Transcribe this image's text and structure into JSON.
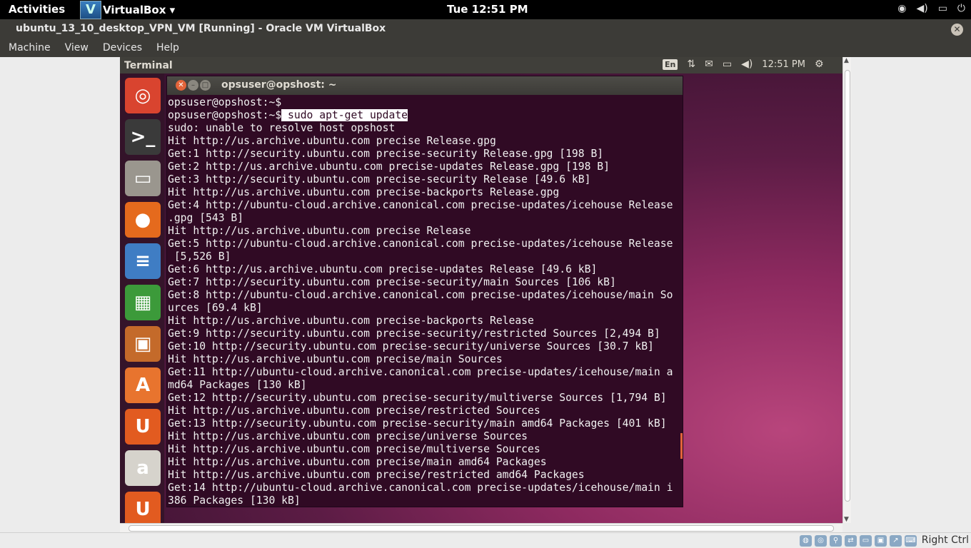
{
  "host_topbar": {
    "activities": "Activities",
    "app_name": "VirtualBox ▾",
    "clock": "Tue 12:51 PM",
    "tray_icons": [
      "wifi-icon",
      "volume-icon",
      "battery-icon",
      "power-icon"
    ]
  },
  "vbox": {
    "title": "ubuntu_13_10_desktop_VPN_VM [Running] - Oracle VM VirtualBox",
    "menu": [
      "Machine",
      "View",
      "Devices",
      "Help"
    ],
    "host_key": "Right Ctrl"
  },
  "guest_panel": {
    "app_title": "Terminal",
    "lang": "En",
    "clock": "12:51 PM"
  },
  "launcher": [
    {
      "name": "ubuntu-dash-icon",
      "glyph": "◎",
      "color": "#d9442f"
    },
    {
      "name": "terminal-icon",
      "glyph": ">_",
      "color": "#3a3a3a"
    },
    {
      "name": "files-icon",
      "glyph": "▭",
      "color": "#9a968e"
    },
    {
      "name": "firefox-icon",
      "glyph": "●",
      "color": "#e56a1d"
    },
    {
      "name": "libreoffice-writer-icon",
      "glyph": "≡",
      "color": "#3f7dc4"
    },
    {
      "name": "libreoffice-calc-icon",
      "glyph": "▦",
      "color": "#3c9a3a"
    },
    {
      "name": "libreoffice-impress-icon",
      "glyph": "▣",
      "color": "#c46a2a"
    },
    {
      "name": "software-center-icon",
      "glyph": "A",
      "color": "#e8742e"
    },
    {
      "name": "ubuntu-one-icon",
      "glyph": "U",
      "color": "#e25b20"
    },
    {
      "name": "amazon-icon",
      "glyph": "a",
      "color": "#d6d3cc"
    },
    {
      "name": "ubuntu-one-music-icon",
      "glyph": "U",
      "color": "#e25b20"
    }
  ],
  "terminal": {
    "title": "opsuser@opshost: ~",
    "prompt": "opsuser@opshost:~$",
    "command": " sudo apt-get update",
    "output": [
      "sudo: unable to resolve host opshost",
      "Hit http://us.archive.ubuntu.com precise Release.gpg",
      "Get:1 http://security.ubuntu.com precise-security Release.gpg [198 B]",
      "Get:2 http://us.archive.ubuntu.com precise-updates Release.gpg [198 B]",
      "Get:3 http://security.ubuntu.com precise-security Release [49.6 kB]",
      "Hit http://us.archive.ubuntu.com precise-backports Release.gpg",
      "Get:4 http://ubuntu-cloud.archive.canonical.com precise-updates/icehouse Release",
      ".gpg [543 B]",
      "Hit http://us.archive.ubuntu.com precise Release",
      "Get:5 http://ubuntu-cloud.archive.canonical.com precise-updates/icehouse Release",
      " [5,526 B]",
      "Get:6 http://us.archive.ubuntu.com precise-updates Release [49.6 kB]",
      "Get:7 http://security.ubuntu.com precise-security/main Sources [106 kB]",
      "Get:8 http://ubuntu-cloud.archive.canonical.com precise-updates/icehouse/main So",
      "urces [69.4 kB]",
      "Hit http://us.archive.ubuntu.com precise-backports Release",
      "Get:9 http://security.ubuntu.com precise-security/restricted Sources [2,494 B]",
      "Get:10 http://security.ubuntu.com precise-security/universe Sources [30.7 kB]",
      "Hit http://us.archive.ubuntu.com precise/main Sources",
      "Get:11 http://ubuntu-cloud.archive.canonical.com precise-updates/icehouse/main a",
      "md64 Packages [130 kB]",
      "Get:12 http://security.ubuntu.com precise-security/multiverse Sources [1,794 B]",
      "Hit http://us.archive.ubuntu.com precise/restricted Sources",
      "Get:13 http://security.ubuntu.com precise-security/main amd64 Packages [401 kB]",
      "Hit http://us.archive.ubuntu.com precise/universe Sources",
      "Hit http://us.archive.ubuntu.com precise/multiverse Sources",
      "Hit http://us.archive.ubuntu.com precise/main amd64 Packages",
      "Hit http://us.archive.ubuntu.com precise/restricted amd64 Packages",
      "Get:14 http://ubuntu-cloud.archive.canonical.com precise-updates/icehouse/main i",
      "386 Packages [130 kB]"
    ]
  },
  "colors": {
    "terminal_bg": "#300a24",
    "terminal_fg": "#f0f0f0",
    "accent": "#e2643a"
  }
}
